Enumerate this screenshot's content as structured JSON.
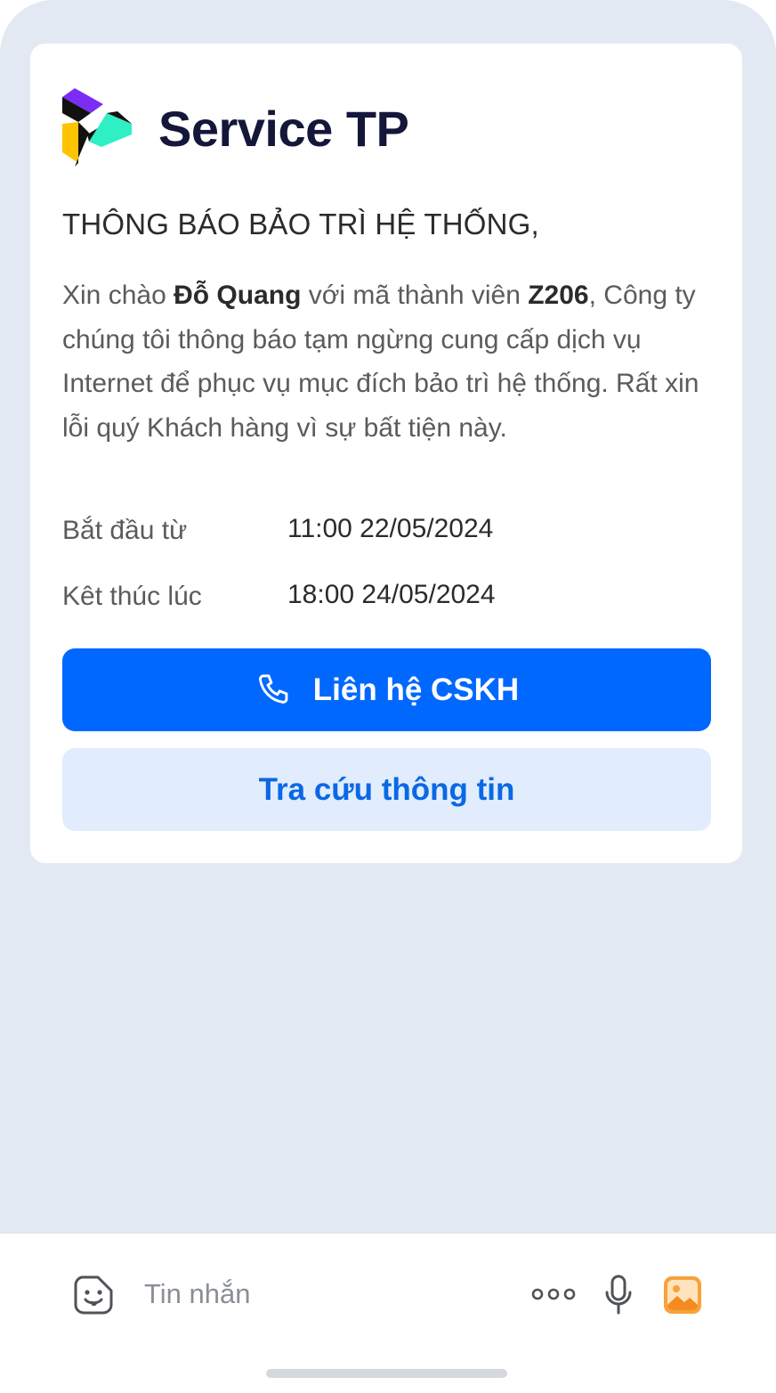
{
  "brand": {
    "name": "Service TP",
    "logo_icon": "service-tp-logo"
  },
  "notice": {
    "title": "THÔNG BÁO BẢO TRÌ HỆ THỐNG,",
    "greeting_prefix": "Xin chào ",
    "customer_name": "Đỗ Quang",
    "member_code_prefix": " với mã thành viên ",
    "member_code": "Z206",
    "greeting_suffix": ",",
    "message": " Công ty chúng tôi thông báo tạm ngừng cung cấp dịch vụ Internet để phục vụ mục đích bảo trì hệ thống. Rất xin lỗi quý Khách hàng vì sự bất tiện này."
  },
  "schedule": {
    "start_label": "Bắt đầu từ",
    "start_value": "11:00 22/05/2024",
    "end_label": "Kêt thúc lúc",
    "end_value": "18:00 24/05/2024"
  },
  "actions": {
    "contact_label": "Liên hệ CSKH",
    "contact_icon": "phone-icon",
    "lookup_label": "Tra cứu thông tin"
  },
  "composer": {
    "placeholder": "Tin nhắn",
    "value": "",
    "emoji_icon": "sticker-icon",
    "more_icon": "more-dots-icon",
    "mic_icon": "microphone-icon",
    "image_icon": "image-icon"
  },
  "colors": {
    "chat_background": "#e2e9f2",
    "primary": "#0068ff",
    "secondary_bg": "#e1edfc",
    "brand_text": "#14163a",
    "logo_purple": "#7b2cf5",
    "logo_yellow": "#ffc400",
    "logo_teal": "#2ef0c2",
    "image_icon_orange": "#f7a23b"
  }
}
